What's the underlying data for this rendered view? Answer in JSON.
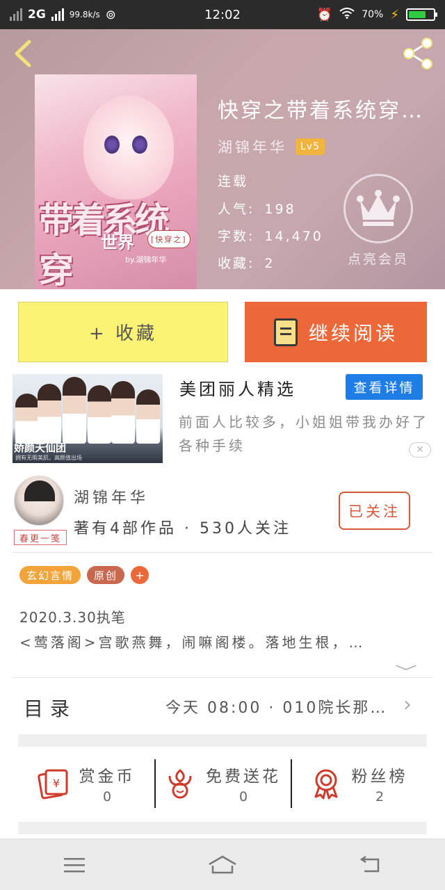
{
  "status_bar": {
    "network": "2G",
    "speed": "99.8k/s",
    "time": "12:02",
    "battery": "70%",
    "battery_level": 0.7
  },
  "book": {
    "title": "快穿之带着系统穿…",
    "author": "湖锦年华",
    "level": "Lv5",
    "status": "连载",
    "popularity_label": "人气:",
    "popularity": "198",
    "words_label": "字数:",
    "words": "14,470",
    "favorites_label": "收藏:",
    "favorites": "2",
    "cover_art_title": "带着系统穿",
    "cover_art_world": "世界",
    "cover_art_tag": "[快穿之]",
    "cover_art_by": "by.湖锦年华"
  },
  "vip": {
    "label": "点亮会员"
  },
  "actions": {
    "favorite_label": "+ 收藏",
    "read_label": "继续阅读"
  },
  "ad": {
    "brand": "娇颜天仙团",
    "brand_sub": "拥有无暇美肌，高颜值出场",
    "title": "美团丽人精选",
    "button": "查看详情",
    "description": "前面人比较多，小姐姐带我办好了各种手续",
    "close": "✕"
  },
  "author_card": {
    "name": "湖锦年华",
    "stamp": "春更一笺",
    "stats": "著有4部作品 · 530人关注",
    "follow_label": "已关注"
  },
  "tags": [
    {
      "label": "玄幻言情",
      "color": "#f2a43a"
    },
    {
      "label": "原创",
      "color": "#c8684f"
    }
  ],
  "tag_add": "+",
  "intro": {
    "line1": "2020.3.30执笔",
    "line2": "<莺落阁>宫歌燕舞，闹嘛阁楼。落地生根，…"
  },
  "toc": {
    "label": "目录",
    "latest": "今天 08:00 · 010院长那…"
  },
  "stats": [
    {
      "label": "赏金币",
      "value": "0",
      "icon": "red-envelope-icon"
    },
    {
      "label": "免费送花",
      "value": "0",
      "icon": "flower-icon"
    },
    {
      "label": "粉丝榜",
      "value": "2",
      "icon": "medal-icon"
    }
  ],
  "colors": {
    "accent_orange": "#ec6838",
    "favorite_yellow": "#fbf376",
    "ad_blue": "#1e7ee6",
    "level_badge": "#f2b33f"
  }
}
